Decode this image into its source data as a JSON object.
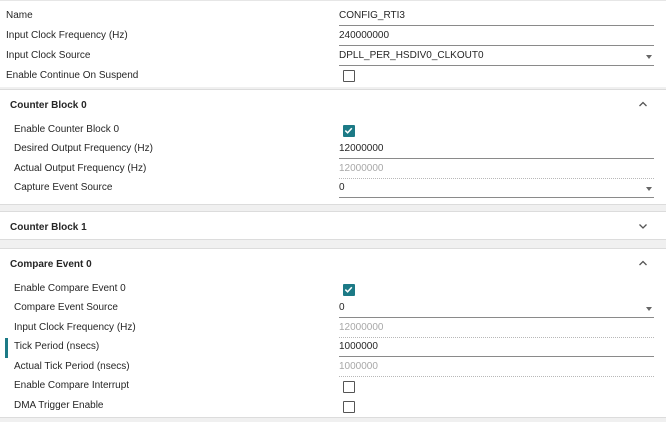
{
  "general": {
    "name_label": "Name",
    "name_value": "CONFIG_RTI3",
    "input_freq_label": "Input Clock Frequency (Hz)",
    "input_freq_value": "240000000",
    "input_src_label": "Input Clock Source",
    "input_src_value": "DPLL_PER_HSDIV0_CLKOUT0",
    "continue_label": "Enable Continue On Suspend",
    "continue_checked": false
  },
  "counter_block_0": {
    "title": "Counter Block 0",
    "expanded": true,
    "enable_label": "Enable Counter Block 0",
    "enable_checked": true,
    "desired_freq_label": "Desired Output Frequency (Hz)",
    "desired_freq_value": "12000000",
    "actual_freq_label": "Actual Output Frequency (Hz)",
    "actual_freq_value": "12000000",
    "capture_src_label": "Capture Event Source",
    "capture_src_value": "0"
  },
  "counter_block_1": {
    "title": "Counter Block 1",
    "expanded": false
  },
  "compare_event_0": {
    "title": "Compare Event 0",
    "expanded": true,
    "enable_label": "Enable Compare Event 0",
    "enable_checked": true,
    "source_label": "Compare Event Source",
    "source_value": "0",
    "input_freq_label": "Input Clock Frequency (Hz)",
    "input_freq_value": "12000000",
    "tick_label": "Tick Period (nsecs)",
    "tick_value": "1000000",
    "actual_tick_label": "Actual Tick Period (nsecs)",
    "actual_tick_value": "1000000",
    "interrupt_label": "Enable Compare Interrupt",
    "interrupt_checked": false,
    "dma_label": "DMA Trigger Enable",
    "dma_checked": false
  },
  "colors": {
    "accent": "#1c7a86",
    "background": "#f0f0f0",
    "panel": "#ffffff",
    "readonly_text": "#a8a8a8"
  }
}
